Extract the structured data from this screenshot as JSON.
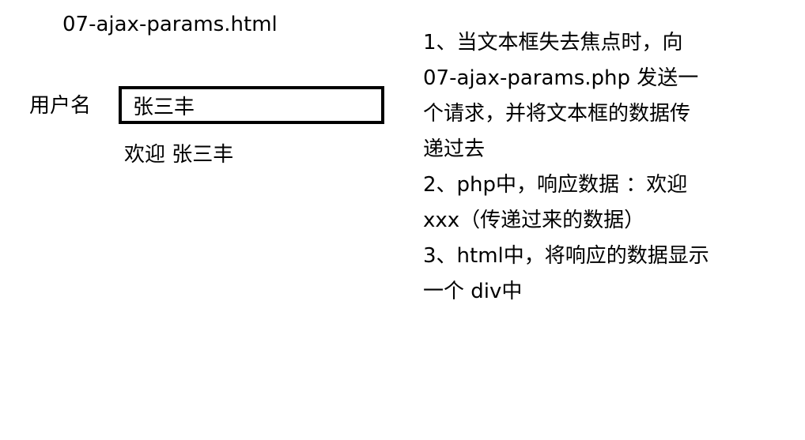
{
  "page": {
    "title": "07-ajax-params.html"
  },
  "form": {
    "username_label": "用户名",
    "username_value": "张三丰"
  },
  "result": {
    "message": "欢迎 张三丰"
  },
  "instructions": {
    "lines": [
      "1、当文本框失去焦点时，向",
      "07-ajax-params.php 发送一",
      "个请求，并将文本框的数据传",
      "递过去",
      "2、php中，响应数据 ：欢迎",
      "xxx（传递过来的数据）",
      "3、html中，将响应的数据显示",
      "一个 div中"
    ]
  }
}
